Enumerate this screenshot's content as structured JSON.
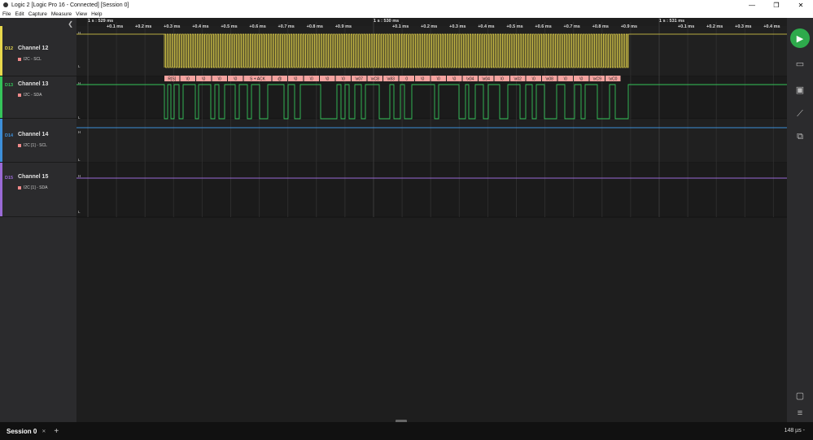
{
  "window": {
    "title": "Logic 2 [Logic Pro 16 - Connected] [Session 0]",
    "minimize": "—",
    "restore": "❐",
    "close": "✕"
  },
  "menu": [
    "File",
    "Edit",
    "Capture",
    "Measure",
    "View",
    "Help"
  ],
  "sidebar": {
    "collapse_glyph": "❮",
    "channels": [
      {
        "id": "D12",
        "name": "Channel 12",
        "analyzer": "I2C - SCL",
        "color": "#e8d84c"
      },
      {
        "id": "D13",
        "name": "Channel 13",
        "analyzer": "I2C - SDA",
        "color": "#35c45a"
      },
      {
        "id": "D14",
        "name": "Channel 14",
        "analyzer": "I2C [1] - SCL",
        "color": "#3d8fd9"
      },
      {
        "id": "D15",
        "name": "Channel 15",
        "analyzer": "I2C [1] - SDA",
        "color": "#9a6ad6"
      }
    ]
  },
  "timeline": {
    "major_labels": [
      "1 s : 529 ms",
      "1 s : 530 ms",
      "1 s : 531 ms"
    ],
    "ticks_a": [
      "+0.1 ms",
      "+0.2 ms",
      "+0.3 ms",
      "+0.4 ms",
      "+0.5 ms",
      "+0.6 ms",
      "+0.7 ms",
      "+0.8 ms",
      "+0.9 ms"
    ],
    "ticks_b": [
      "+0.1 ms",
      "+0.2 ms",
      "+0.3 ms",
      "+0.4 ms",
      "+0.5 ms",
      "+0.6 ms",
      "+0.7 ms",
      "+0.8 ms",
      "+0.9 ms"
    ],
    "ticks_c": [
      "+0.1 ms",
      "+0.2 ms",
      "+0.3 ms",
      "+0.4 ms"
    ],
    "high_label": "H",
    "low_label": "L",
    "decoded": [
      "R[S]",
      "\\0",
      "\\0",
      "\\0",
      "\\0",
      "S + ACK",
      "@",
      "\\0",
      "\\0",
      "\\0",
      "\\0",
      "\\x07",
      "\\xC8",
      "\\x83",
      "0",
      "\\0",
      "\\0",
      "\\0",
      "\\x04",
      "\\x04",
      "\\0",
      "\\x02",
      "\\0",
      "\\x08",
      "\\0",
      "\\0",
      "\\xC9",
      "\\xC0"
    ],
    "decoded_color": "#f5a3a0"
  },
  "right_toolbar": {
    "play_glyph": "▶",
    "icons": [
      "analyzers-icon",
      "measurements-icon",
      "timing-markers-icon",
      "extensions-icon",
      "comments-icon",
      "menu-icon"
    ]
  },
  "bottom": {
    "session_tab": "Session 0",
    "close_glyph": "✕",
    "add_glyph": "+",
    "zoom": "148 µs -"
  }
}
